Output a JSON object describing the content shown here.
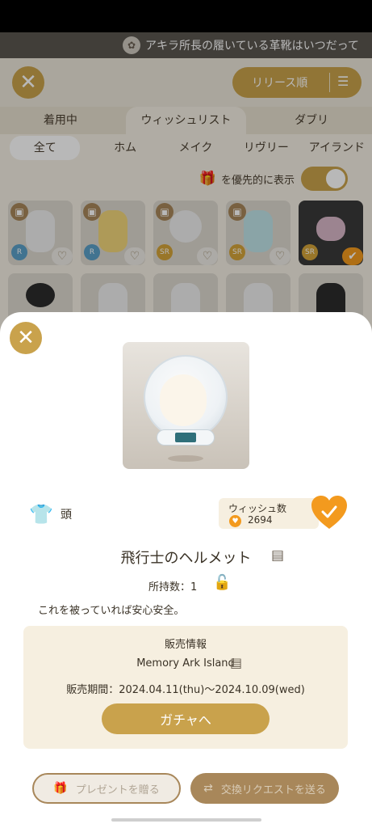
{
  "ticker": {
    "text": "アキラ所長の履いている革靴はいつだって"
  },
  "topbar": {
    "sort_label": "リリース順"
  },
  "tabs_main": [
    "着用中",
    "ウィッシュリスト",
    "ダブリ"
  ],
  "tabs_sub": [
    "全て",
    "ホム",
    "メイク",
    "リヴリー",
    "アイランド"
  ],
  "pref": {
    "label": "を優先的に表示"
  },
  "grid": {
    "row1": [
      {
        "rarity": "R",
        "rarity_color": "#5aa0c8"
      },
      {
        "rarity": "R",
        "rarity_color": "#5aa0c8"
      },
      {
        "rarity": "SR",
        "rarity_color": "#d4a43a"
      },
      {
        "rarity": "SR",
        "rarity_color": "#d4a43a"
      },
      {
        "rarity": "SR",
        "rarity_color": "#d4a43a"
      }
    ]
  },
  "item": {
    "category": "頭",
    "wish_title": "ウィッシュ数",
    "wish_count": "2694",
    "name": "飛行士のヘルメット",
    "owned": "所持数：1",
    "description": "これを被っていれば安心安全。"
  },
  "sale": {
    "title": "販売情報",
    "place": "Memory Ark Island",
    "period": "販売期間：2024.04.11(thu)〜2024.10.09(wed)",
    "gacha_label": "ガチャへ"
  },
  "actions": {
    "present_label": "プレゼントを贈る",
    "exchange_label": "交換リクエストを送る"
  },
  "colors": {
    "accent": "#c9a24c",
    "heart": "#f39a1e"
  }
}
